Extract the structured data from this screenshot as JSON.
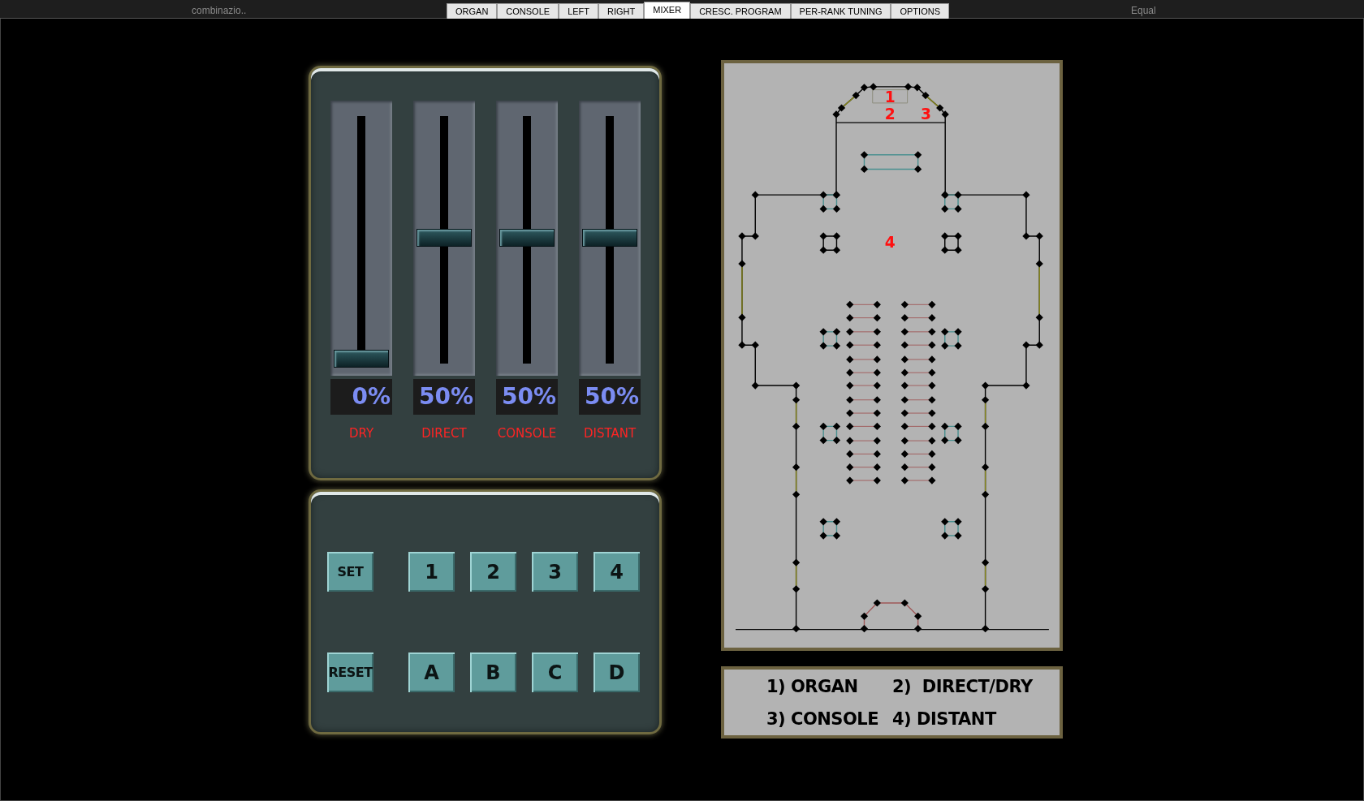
{
  "top_bar": {
    "left_text": "combinazio..",
    "right_text": "Equal"
  },
  "tabs": [
    {
      "label": "ORGAN",
      "selected": false
    },
    {
      "label": "CONSOLE",
      "selected": false
    },
    {
      "label": "LEFT",
      "selected": false
    },
    {
      "label": "RIGHT",
      "selected": false
    },
    {
      "label": "MIXER",
      "selected": true
    },
    {
      "label": "CRESC. PROGRAM",
      "selected": false
    },
    {
      "label": "PER-RANK TUNING",
      "selected": false
    },
    {
      "label": "OPTIONS",
      "selected": false
    }
  ],
  "channels": [
    {
      "name": "DRY",
      "level": 0,
      "reading": "0%"
    },
    {
      "name": "DIRECT",
      "level": 0.5,
      "reading": "50%"
    },
    {
      "name": "CONSOLE",
      "level": 0.5,
      "reading": "50%"
    },
    {
      "name": "DISTANT",
      "level": 0.5,
      "reading": "50%"
    }
  ],
  "preset_buttons": [
    [
      {
        "label": "SET",
        "kind": "action"
      },
      {
        "label": "1",
        "kind": "slot"
      },
      {
        "label": "2",
        "kind": "slot"
      },
      {
        "label": "3",
        "kind": "slot"
      },
      {
        "label": "4",
        "kind": "slot"
      }
    ],
    [
      {
        "label": "RESET",
        "kind": "action"
      },
      {
        "label": "A",
        "kind": "slot"
      },
      {
        "label": "B",
        "kind": "slot"
      },
      {
        "label": "C",
        "kind": "slot"
      },
      {
        "label": "D",
        "kind": "slot"
      }
    ]
  ],
  "plan": {
    "markers": [
      "1",
      "2",
      "3",
      "4"
    ]
  },
  "legend": [
    "1) ORGAN",
    "2)  DIRECT/DRY",
    "3) CONSOLE",
    "4) DISTANT"
  ]
}
